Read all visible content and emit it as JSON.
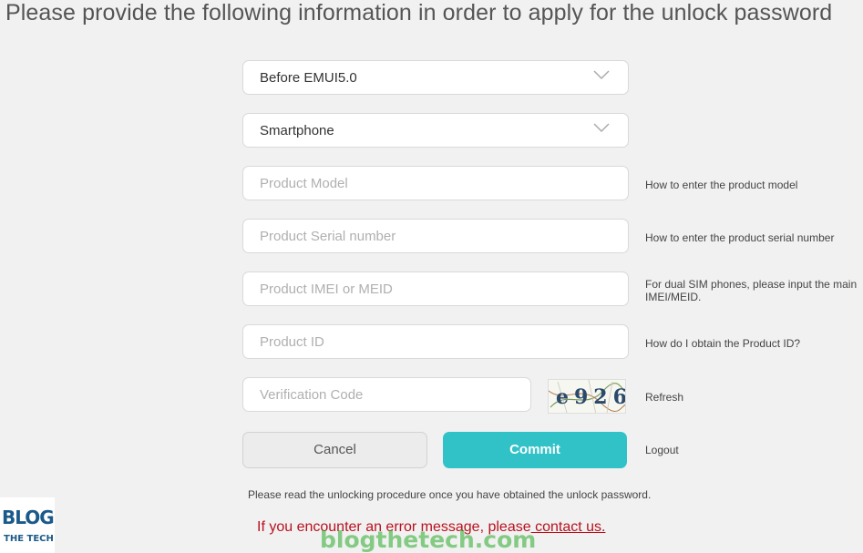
{
  "page": {
    "heading": "Please provide the following information in order to apply for the unlock password"
  },
  "form": {
    "system_version": {
      "selected": "Before EMUI5.0",
      "icon": "chevron-down-icon"
    },
    "device_type": {
      "selected": "Smartphone",
      "icon": "chevron-down-icon"
    },
    "product_model": {
      "placeholder": "Product Model",
      "value": ""
    },
    "serial_number": {
      "placeholder": "Product Serial number",
      "value": ""
    },
    "imei": {
      "placeholder": "Product IMEI or MEID",
      "value": ""
    },
    "product_id": {
      "placeholder": "Product ID",
      "value": ""
    },
    "verification_code": {
      "placeholder": "Verification Code",
      "value": ""
    },
    "captcha_text": "e926"
  },
  "hints": {
    "product_model": "How to enter the product model",
    "serial_number": "How to enter the product serial number",
    "imei": "For dual SIM phones, please input the main IMEI/MEID.",
    "product_id": "How do I obtain the Product ID?",
    "refresh": "Refresh",
    "logout": "Logout"
  },
  "buttons": {
    "cancel": "Cancel",
    "commit": "Commit"
  },
  "footer": {
    "note": "Please read the unlocking procedure once you have obtained the unlock password.",
    "error_text": "If you encounter an error message, please",
    "contact_link": " contact us."
  },
  "branding": {
    "logo_line1": "BLOG",
    "logo_line2": "THE TECH",
    "watermark": "blogthetech.com"
  },
  "colors": {
    "commit_bg": "#31c2c8",
    "error_text": "#b8121e",
    "background": "#f1f1f1"
  }
}
